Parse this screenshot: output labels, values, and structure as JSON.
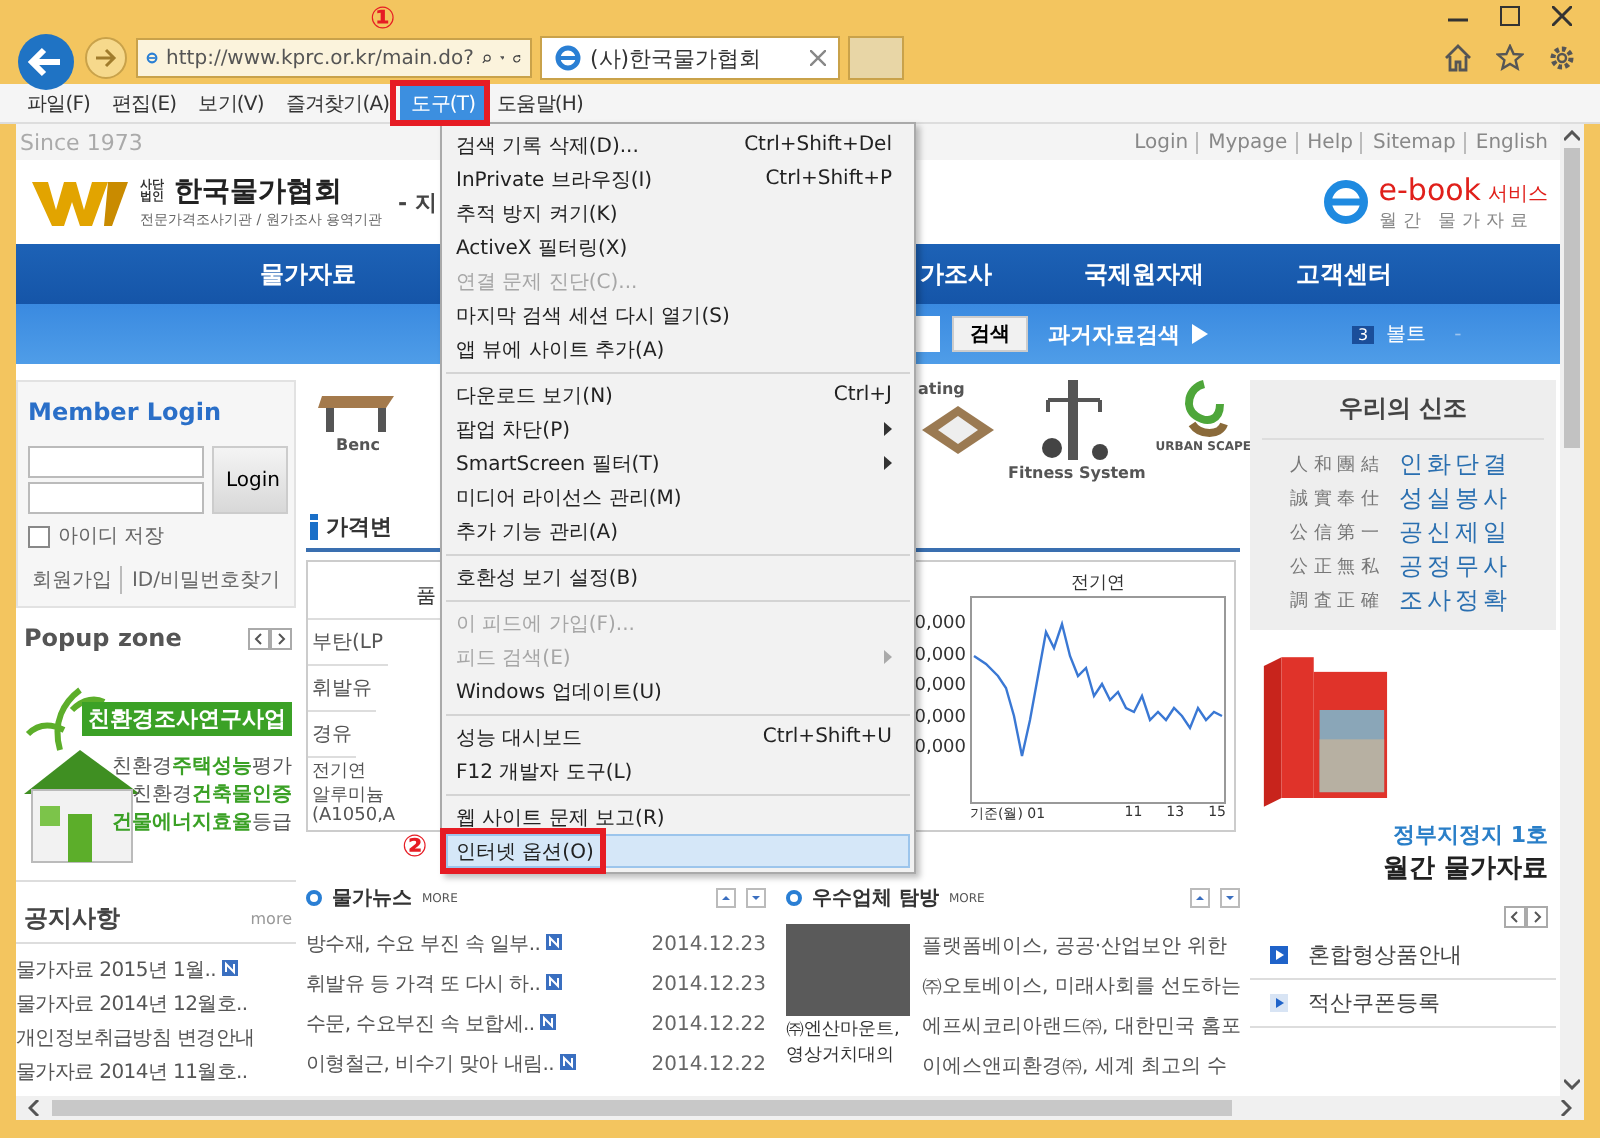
{
  "browser": {
    "url": "http://www.kprc.or.kr/main.do?",
    "tab_title": "(사)한국물가협회"
  },
  "menu_bar": [
    {
      "label": "파일(F)",
      "selected": false
    },
    {
      "label": "편집(E)",
      "selected": false
    },
    {
      "label": "보기(V)",
      "selected": false
    },
    {
      "label": "즐겨찾기(A)",
      "selected": false
    },
    {
      "label": "도구(T)",
      "selected": true
    },
    {
      "label": "도움말(H)",
      "selected": false
    }
  ],
  "tools_menu": {
    "groups": [
      [
        {
          "label": "검색 기록 삭제(D)...",
          "shortcut": "Ctrl+Shift+Del",
          "disabled": false,
          "submenu": false,
          "selected": false
        },
        {
          "label": "InPrivate 브라우징(I)",
          "shortcut": "Ctrl+Shift+P",
          "disabled": false,
          "submenu": false,
          "selected": false
        },
        {
          "label": "추적 방지 켜기(K)",
          "disabled": false,
          "submenu": false,
          "selected": false
        },
        {
          "label": "ActiveX 필터링(X)",
          "disabled": false,
          "submenu": false,
          "selected": false
        },
        {
          "label": "연결 문제 진단(C)...",
          "disabled": true,
          "submenu": false,
          "selected": false
        },
        {
          "label": "마지막 검색 세션 다시 열기(S)",
          "disabled": false,
          "submenu": false,
          "selected": false
        },
        {
          "label": "앱 뷰에 사이트 추가(A)",
          "disabled": false,
          "submenu": false,
          "selected": false
        }
      ],
      [
        {
          "label": "다운로드 보기(N)",
          "shortcut": "Ctrl+J",
          "disabled": false,
          "submenu": false,
          "selected": false
        },
        {
          "label": "팝업 차단(P)",
          "disabled": false,
          "submenu": true,
          "selected": false
        },
        {
          "label": "SmartScreen 필터(T)",
          "disabled": false,
          "submenu": true,
          "selected": false
        },
        {
          "label": "미디어 라이선스 관리(M)",
          "disabled": false,
          "submenu": false,
          "selected": false
        },
        {
          "label": "추가 기능 관리(A)",
          "disabled": false,
          "submenu": false,
          "selected": false
        }
      ],
      [
        {
          "label": "호환성 보기 설정(B)",
          "disabled": false,
          "submenu": false,
          "selected": false
        }
      ],
      [
        {
          "label": "이 피드에 가입(F)...",
          "disabled": true,
          "submenu": false,
          "selected": false
        },
        {
          "label": "피드 검색(E)",
          "disabled": true,
          "submenu": true,
          "selected": false
        },
        {
          "label": "Windows 업데이트(U)",
          "disabled": false,
          "submenu": false,
          "selected": false
        }
      ],
      [
        {
          "label": "성능 대시보드",
          "shortcut": "Ctrl+Shift+U",
          "disabled": false,
          "submenu": false,
          "selected": false
        },
        {
          "label": "F12 개발자 도구(L)",
          "disabled": false,
          "submenu": false,
          "selected": false
        }
      ],
      [
        {
          "label": "웹 사이트 문제 보고(R)",
          "disabled": false,
          "submenu": false,
          "selected": false
        },
        {
          "label": "인터넷 옵션(O)",
          "disabled": false,
          "submenu": false,
          "selected": true
        }
      ]
    ]
  },
  "annotations": [
    {
      "label": "①"
    },
    {
      "label": "②"
    }
  ],
  "site": {
    "since": "Since 1973",
    "top_links": [
      "Login",
      "Mypage",
      "Help",
      "Sitemap",
      "English"
    ],
    "logo": {
      "tag": "사단법인",
      "name": "한국물가협회",
      "subtitle": "전문가격조사기관 / 원가조사 용역기관",
      "slogan": "- 지"
    },
    "ebook": {
      "title": "e-book",
      "suffix": "서비스",
      "subtitle": "월간 물가자료"
    },
    "nav_left": [
      "물가자료"
    ],
    "nav_right": [
      "가조사",
      "국제원자재",
      "고객센터"
    ],
    "search": {
      "button": "검색",
      "archive": "과거자료검색",
      "rank": "3",
      "keyword": "볼트",
      "trailing": "-"
    },
    "login": {
      "title": "Member Login",
      "button": "Login",
      "remember": "아이디 저장",
      "remember_checked": false,
      "join": "회원가입",
      "find": "ID/비밀번호찾기"
    },
    "popup": {
      "title": "Popup zone",
      "banner_title": "친환경조사연구사업",
      "banner_lines": [
        "친환경**주택성능**평가",
        "친환경**건축물인증**",
        "**건물에너지효율**등급"
      ]
    },
    "notices": {
      "title": "공지사항",
      "more": "more",
      "items": [
        {
          "text": "물가자료 2015년 1월..",
          "new": true
        },
        {
          "text": "물가자료 2014년 12월호..",
          "new": false
        },
        {
          "text": "개인정보취급방침 변경안내",
          "new": false
        },
        {
          "text": "물가자료 2014년 11월호..",
          "new": false
        }
      ]
    },
    "products_left": [
      {
        "label": "Benc",
        "kind": "bench"
      }
    ],
    "products_right": [
      {
        "label": "ating",
        "kind": "deck"
      },
      {
        "label": "Fitness System",
        "kind": "fitness"
      },
      {
        "label": "URBAN SCAPE",
        "kind": "logo"
      }
    ],
    "price_table": {
      "title": "가격변",
      "header": "품",
      "rows": [
        "부탄(LP",
        "휘발유",
        "경유",
        "전기연",
        "알루미늄",
        "(A1050,A"
      ]
    },
    "chart": {
      "title": "전기연",
      "y_labels": [
        "0,000",
        "0,000",
        "0,000",
        "0,000",
        "0,000"
      ],
      "x_labels": [
        "기준(월) 01",
        "11",
        "13",
        "15"
      ]
    },
    "news": {
      "title": "물가뉴스",
      "more": "MORE",
      "items": [
        {
          "text": "방수재, 수요 부진 속 일부..",
          "date": "2014.12.23",
          "new": true
        },
        {
          "text": "휘발유 등 가격 또 다시 하..",
          "date": "2014.12.23",
          "new": true
        },
        {
          "text": "수문, 수요부진 속 보합세..",
          "date": "2014.12.22",
          "new": true
        },
        {
          "text": "이형철근, 비수기 맞아 내림..",
          "date": "2014.12.22",
          "new": true
        }
      ]
    },
    "visits": {
      "title": "우수업체 탐방",
      "more": "MORE",
      "caption": [
        "㈜엔산마운트,",
        "영상거치대의"
      ],
      "lines": [
        "플랫폼베이스, 공공·산업보안 위한",
        "㈜오토베이스, 미래사회를 선도하는",
        "에프씨코리아랜드㈜, 대한민국 홈포",
        "이에스앤피환경㈜, 세계 최고의 수"
      ]
    },
    "creed": {
      "title": "우리의 신조",
      "rows": [
        {
          "hanja": "人 和 團 結",
          "hangul": "인화단결"
        },
        {
          "hanja": "誠 實 奉 仕",
          "hangul": "성실봉사"
        },
        {
          "hanja": "公 信 第 一",
          "hangul": "공신제일"
        },
        {
          "hanja": "公 正 無 私",
          "hangul": "공정무사"
        },
        {
          "hanja": "調 査 正 確",
          "hangul": "조사정확"
        }
      ]
    },
    "promo": {
      "line1": "정부지정지 1호",
      "line2": "월간 물가자료"
    },
    "links": [
      {
        "label": "혼합형상품안내",
        "kind": "primary"
      },
      {
        "label": "적산쿠폰등록",
        "kind": "secondary"
      }
    ]
  }
}
